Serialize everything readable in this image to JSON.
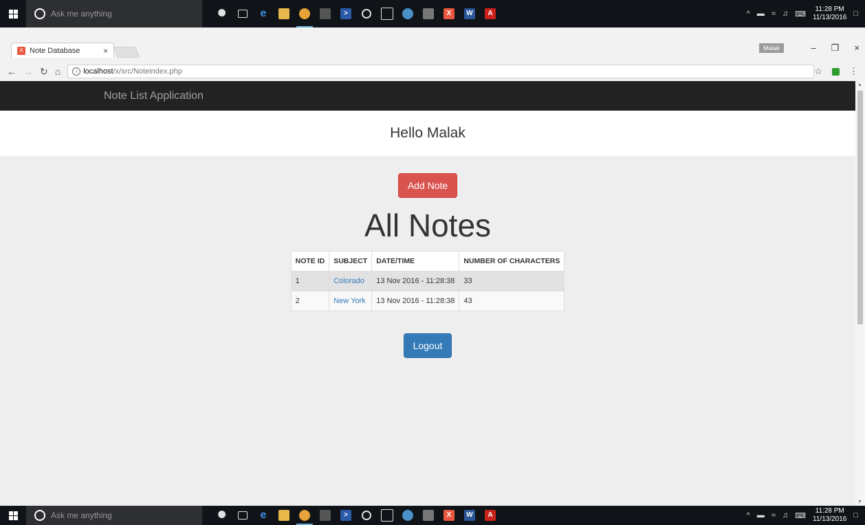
{
  "taskbar": {
    "search_placeholder": "Ask me anything",
    "clock_time": "11:28 PM",
    "clock_date": "11/13/2016"
  },
  "browser": {
    "tab_title": "Note Database",
    "user_badge": "Malak",
    "url_host": "localhost",
    "url_path": "/x/src/Noteindex.php"
  },
  "page": {
    "navbar_brand": "Note List Application",
    "greeting": "Hello Malak",
    "add_note_label": "Add Note",
    "heading": "All Notes",
    "logout_label": "Logout",
    "table": {
      "headers": [
        "NOTE ID",
        "SUBJECT",
        "DATE/TIME",
        "NUMBER OF CHARACTERS"
      ],
      "rows": [
        {
          "id": "1",
          "subject": "Colorado",
          "datetime": "13 Nov 2016 - 11:28:38",
          "chars": "33"
        },
        {
          "id": "2",
          "subject": "New York",
          "datetime": "13 Nov 2016 - 11:28:38",
          "chars": "43"
        }
      ]
    }
  }
}
